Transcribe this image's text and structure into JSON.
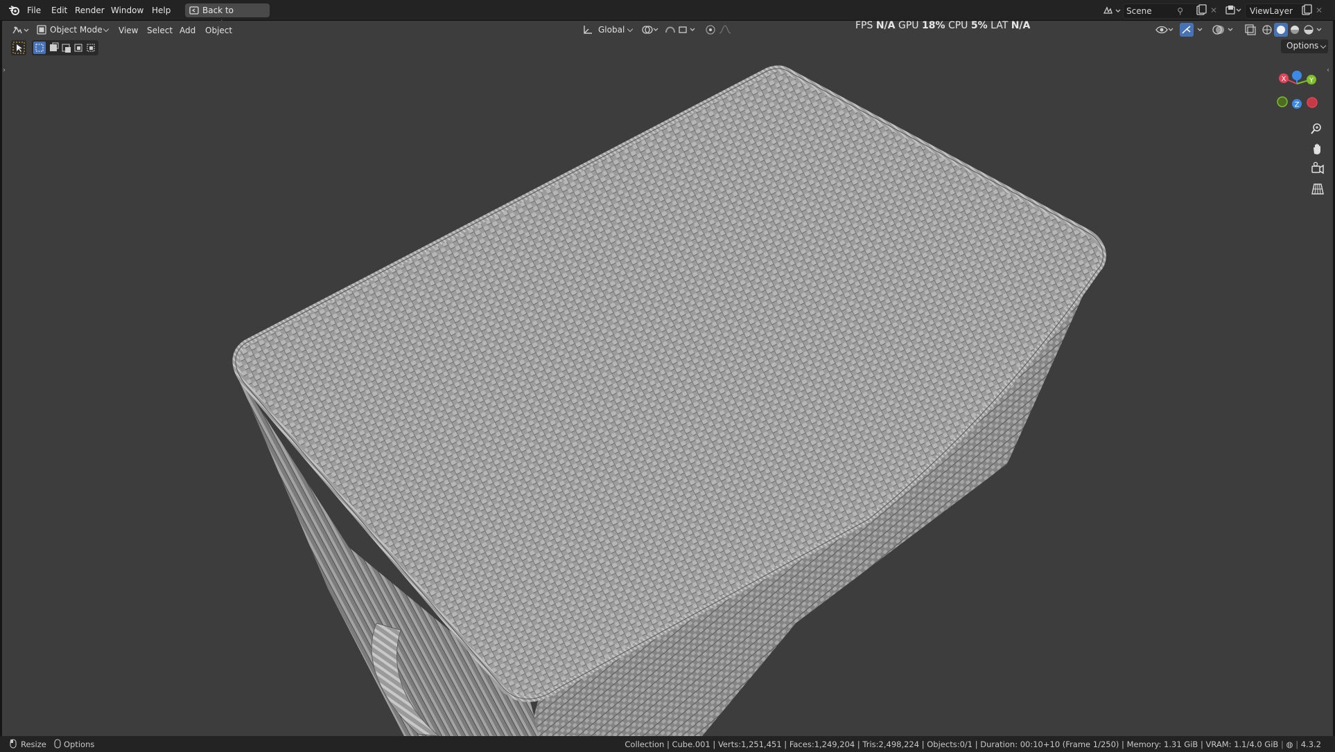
{
  "menu": {
    "file": "File",
    "edit": "Edit",
    "render": "Render",
    "window": "Window",
    "help": "Help"
  },
  "back_button": "Back to Previous",
  "scene": {
    "name": "Scene",
    "view_layer": "ViewLayer"
  },
  "header": {
    "mode": "Object Mode",
    "menus": [
      "View",
      "Select",
      "Add",
      "Object"
    ],
    "transform_orientation": "Global",
    "options_label": "Options"
  },
  "stats": {
    "fps_label": "FPS",
    "fps_value": "N/A",
    "gpu_label": "GPU",
    "gpu_value": "18%",
    "cpu_label": "CPU",
    "cpu_value": "5%",
    "lat_label": "LAT",
    "lat_value": "N/A"
  },
  "gizmo": {
    "x": "X",
    "y": "Y",
    "z": "Z"
  },
  "status": {
    "resize": "Resize",
    "options": "Options",
    "info": "Collection | Cube.001 | Verts:1,251,451 | Faces:1,249,204 | Tris:2,498,224 | Objects:0/1 | Duration: 00:10+10 (Frame 1/250) | Memory: 1.31 GiB | VRAM: 1.1/4.0 GiB",
    "version": "4.3.2"
  },
  "colors": {
    "viewport_bg": "#3d3d3d",
    "axis_x": "#e44458",
    "axis_y": "#7fbf2a",
    "axis_z": "#3d8ae6",
    "accent": "#4772b3"
  },
  "icons": [
    "blender-logo-icon",
    "editor-type-icon",
    "select-box-icon",
    "zoom-icon",
    "hand-pan-icon",
    "camera-icon",
    "grid-icon",
    "workspace-icon",
    "viewlayer-icon"
  ]
}
